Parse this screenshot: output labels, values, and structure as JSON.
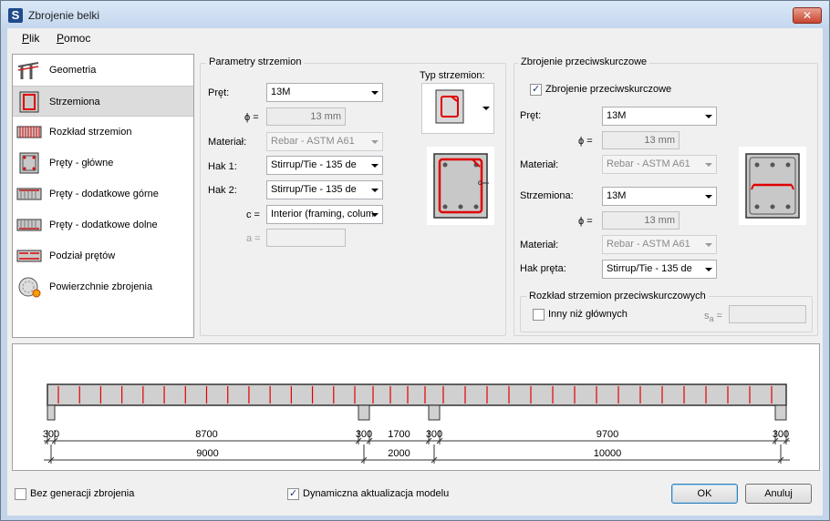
{
  "window": {
    "title": "Zbrojenie belki",
    "app_icon": "S"
  },
  "menu": [
    {
      "label": "Plik",
      "accel": "P",
      "rest": "lik"
    },
    {
      "label": "Pomoc",
      "accel": "P",
      "rest": "omoc"
    }
  ],
  "nav": [
    {
      "label": "Geometria",
      "icon": "geometry-icon"
    },
    {
      "label": "Strzemiona",
      "icon": "stirrups-icon",
      "selected": true
    },
    {
      "label": "Rozkład strzemion",
      "icon": "stirrup-distribution-icon"
    },
    {
      "label": "Pręty - główne",
      "icon": "main-bars-icon"
    },
    {
      "label": "Pręty - dodatkowe górne",
      "icon": "top-bars-icon"
    },
    {
      "label": "Pręty - dodatkowe dolne",
      "icon": "bottom-bars-icon"
    },
    {
      "label": "Podział prętów",
      "icon": "bar-split-icon"
    },
    {
      "label": "Powierzchnie zbrojenia",
      "icon": "reinforcement-area-icon"
    }
  ],
  "stirrups": {
    "group_title": "Parametry strzemion",
    "bar_label": "Pręt:",
    "bar_value": "13M",
    "diameter_label": "ϕ =",
    "diameter_value": "13 mm",
    "material_label": "Materiał:",
    "material_value": "Rebar - ASTM A61",
    "hook1_label": "Hak 1:",
    "hook1_value": "Stirrup/Tie - 135 de",
    "hook2_label": "Hak 2:",
    "hook2_value": "Stirrup/Tie - 135 de",
    "c_label": "c =",
    "c_value": "Interior (framing, colum",
    "a_label": "a =",
    "a_value": "",
    "type_label": "Typ strzemion:"
  },
  "shear": {
    "group_title": "Zbrojenie przeciwskurczowe",
    "checkbox_label": "Zbrojenie przeciwskurczowe",
    "checkbox_checked": true,
    "bar_label": "Pręt:",
    "bar_value": "13M",
    "diameter_label": "ϕ =",
    "diameter_value": "13 mm",
    "material_label": "Materiał:",
    "material_value": "Rebar - ASTM A61",
    "stirrups_label": "Strzemiona:",
    "stirrups_value": "13M",
    "diameter2_label": "ϕ =",
    "diameter2_value": "13 mm",
    "material2_label": "Materiał:",
    "material2_value": "Rebar - ASTM A61",
    "hook_label": "Hak pręta:",
    "hook_value": "Stirrup/Tie - 135 de",
    "dist_group_title": "Rozkład strzemion przeciwskurczowych",
    "other_label": "Inny niż głównych",
    "other_checked": false,
    "sa_label": "s",
    "sa_sub": "a",
    "sa_eq": " =",
    "sa_value": ""
  },
  "beam": {
    "dims_row1": [
      "300",
      "8700",
      "300",
      "1700",
      "300",
      "9700",
      "300"
    ],
    "dims_row2": [
      "9000",
      "2000",
      "10000"
    ],
    "stirrup_color": "#e00000"
  },
  "footer": {
    "no_gen_label": "Bez generacji zbrojenia",
    "no_gen_checked": false,
    "dynamic_label": "Dynamiczna aktualizacja modelu",
    "dynamic_checked": true,
    "ok_label": "OK",
    "cancel_label": "Anuluj"
  }
}
